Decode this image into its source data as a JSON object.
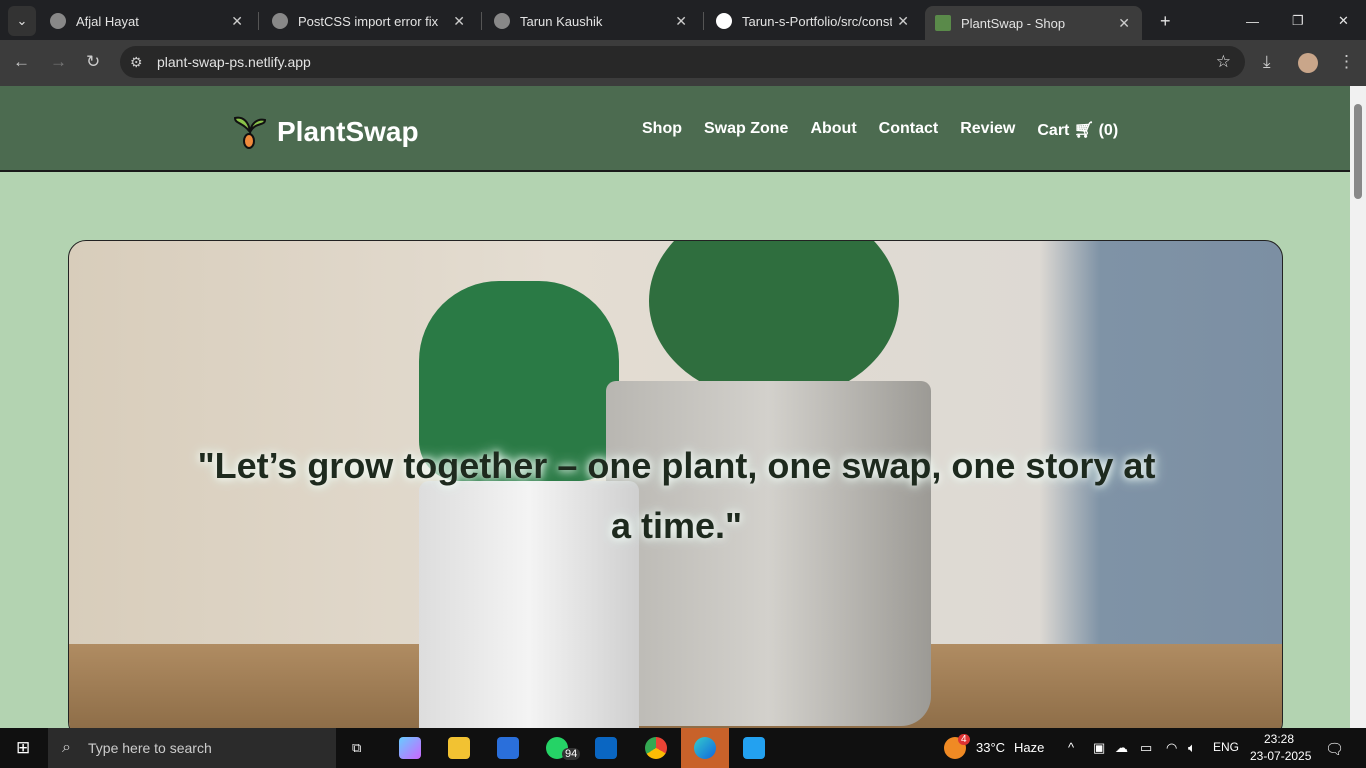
{
  "browser": {
    "tabs": [
      {
        "title": "Afjal Hayat"
      },
      {
        "title": "PostCSS import error fix"
      },
      {
        "title": "Tarun Kaushik"
      },
      {
        "title": "Tarun-s-Portfolio/src/consta"
      },
      {
        "title": "PlantSwap - Shop"
      }
    ],
    "url": "plant-swap-ps.netlify.app"
  },
  "site": {
    "brand": "PlantSwap",
    "nav": [
      "Shop",
      "Swap Zone",
      "About",
      "Contact",
      "Review"
    ],
    "cart_label": "Cart",
    "cart_count": "(0)"
  },
  "hero": {
    "quote": "\"Let’s grow together – one plant, one swap, one story at a time.\""
  },
  "taskbar": {
    "search_placeholder": "Type here to search",
    "whatsapp_badge": "94",
    "weather_badge": "4",
    "temperature": "33°C",
    "weather": "Haze",
    "language": "ENG",
    "time": "23:28",
    "date": "23-07-2025"
  }
}
